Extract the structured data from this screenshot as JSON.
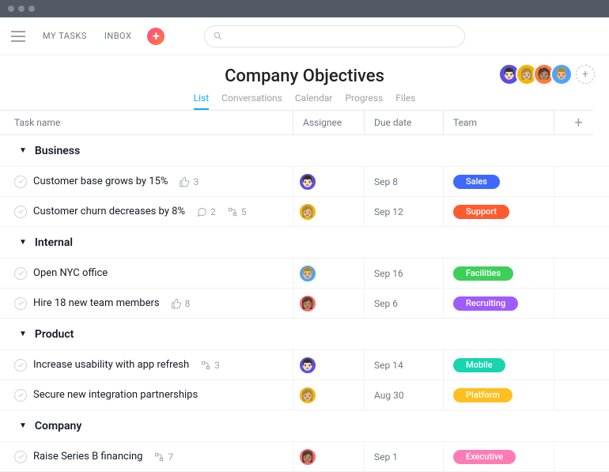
{
  "nav": {
    "my_tasks": "MY TASKS",
    "inbox": "INBOX"
  },
  "search": {
    "placeholder": ""
  },
  "project": {
    "title": "Company Objectives",
    "members": [
      {
        "color": "#5b4ee6",
        "emoji": "👨🏻"
      },
      {
        "color": "#f7b500",
        "emoji": "👩🏼"
      },
      {
        "color": "#ff7b3d",
        "emoji": "🧑🏽"
      },
      {
        "color": "#4da3ff",
        "emoji": "👨🏼"
      }
    ]
  },
  "tabs": [
    "List",
    "Conversations",
    "Calendar",
    "Progress",
    "Files"
  ],
  "columns": {
    "task": "Task name",
    "assignee": "Assignee",
    "due": "Due date",
    "team": "Team"
  },
  "teams": {
    "sales": {
      "label": "Sales",
      "bg": "#3f68ff"
    },
    "support": {
      "label": "Support",
      "bg": "#ff5b2e"
    },
    "facilities": {
      "label": "Facilities",
      "bg": "#3ecf5a"
    },
    "recruiting": {
      "label": "Recruiting",
      "bg": "#a05bff"
    },
    "mobile": {
      "label": "Mobile",
      "bg": "#19d4b0"
    },
    "platform": {
      "label": "Platform",
      "bg": "#ffbf1f"
    },
    "executive": {
      "label": "Executive",
      "bg": "#ff7bb3"
    }
  },
  "sections": [
    {
      "name": "Business",
      "tasks": [
        {
          "name": "Customer base grows by 15%",
          "likes": 3,
          "assignee": {
            "bg": "#5b4ee6",
            "emoji": "👨🏻"
          },
          "due": "Sep 8",
          "team": "sales"
        },
        {
          "name": "Customer churn decreases by 8%",
          "comments": 2,
          "subtasks": 5,
          "assignee": {
            "bg": "#f7b500",
            "emoji": "👩🏼"
          },
          "due": "Sep 12",
          "team": "support"
        }
      ]
    },
    {
      "name": "Internal",
      "tasks": [
        {
          "name": "Open NYC office",
          "assignee": {
            "bg": "#4da3ff",
            "emoji": "👨🏼"
          },
          "due": "Sep 16",
          "team": "facilities"
        },
        {
          "name": "Hire 18 new team members",
          "likes": 8,
          "assignee": {
            "bg": "#ff6b6b",
            "emoji": "👩🏽"
          },
          "due": "Sep 6",
          "team": "recruiting"
        }
      ]
    },
    {
      "name": "Product",
      "tasks": [
        {
          "name": "Increase usability with app refresh",
          "subtasks": 3,
          "assignee": {
            "bg": "#5b4ee6",
            "emoji": "👨🏻"
          },
          "due": "Sep 14",
          "team": "mobile"
        },
        {
          "name": "Secure new integration partnerships",
          "assignee": {
            "bg": "#f7b500",
            "emoji": "👩🏼"
          },
          "due": "Aug 30",
          "team": "platform"
        }
      ]
    },
    {
      "name": "Company",
      "tasks": [
        {
          "name": "Raise Series B financing",
          "subtasks": 7,
          "assignee": {
            "bg": "#ff6b6b",
            "emoji": "👩🏽"
          },
          "due": "Sep 1",
          "team": "executive"
        }
      ]
    }
  ]
}
